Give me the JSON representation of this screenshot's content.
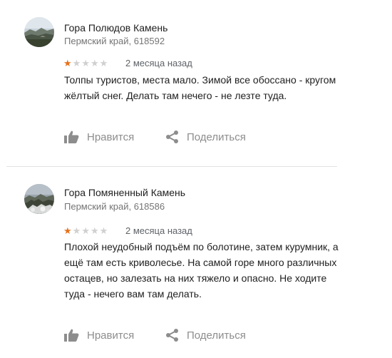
{
  "reviews": [
    {
      "place_name": "Гора Полюдов Камень",
      "address": "Пермский край, 618592",
      "rating": 1,
      "rating_max": 5,
      "date": "2 месяца назад",
      "text": "Толпы туристов, места мало. Зимой все обоссано - кругом жёлтый снег. Делать там нечего - не лезте туда.",
      "like_label": "Нравится",
      "share_label": "Поделиться"
    },
    {
      "place_name": "Гора Помяненный Камень",
      "address": "Пермский край, 618586",
      "rating": 1,
      "rating_max": 5,
      "date": "2 месяца назад",
      "text": "Плохой неудобный подъём по болотине, затем курумник, а ещё там есть криволесье. На самой горе много различных остацев, но залезать на них тяжело и опасно. Не ходите туда - нечего вам там делать.",
      "like_label": "Нравится",
      "share_label": "Поделиться"
    }
  ],
  "colors": {
    "star_filled": "#e7711b",
    "star_empty": "#d0d0d0",
    "action": "#8d8d8d",
    "secondary_text": "#757575"
  },
  "icons": {
    "like": "thumbs-up-icon",
    "share": "share-icon"
  }
}
